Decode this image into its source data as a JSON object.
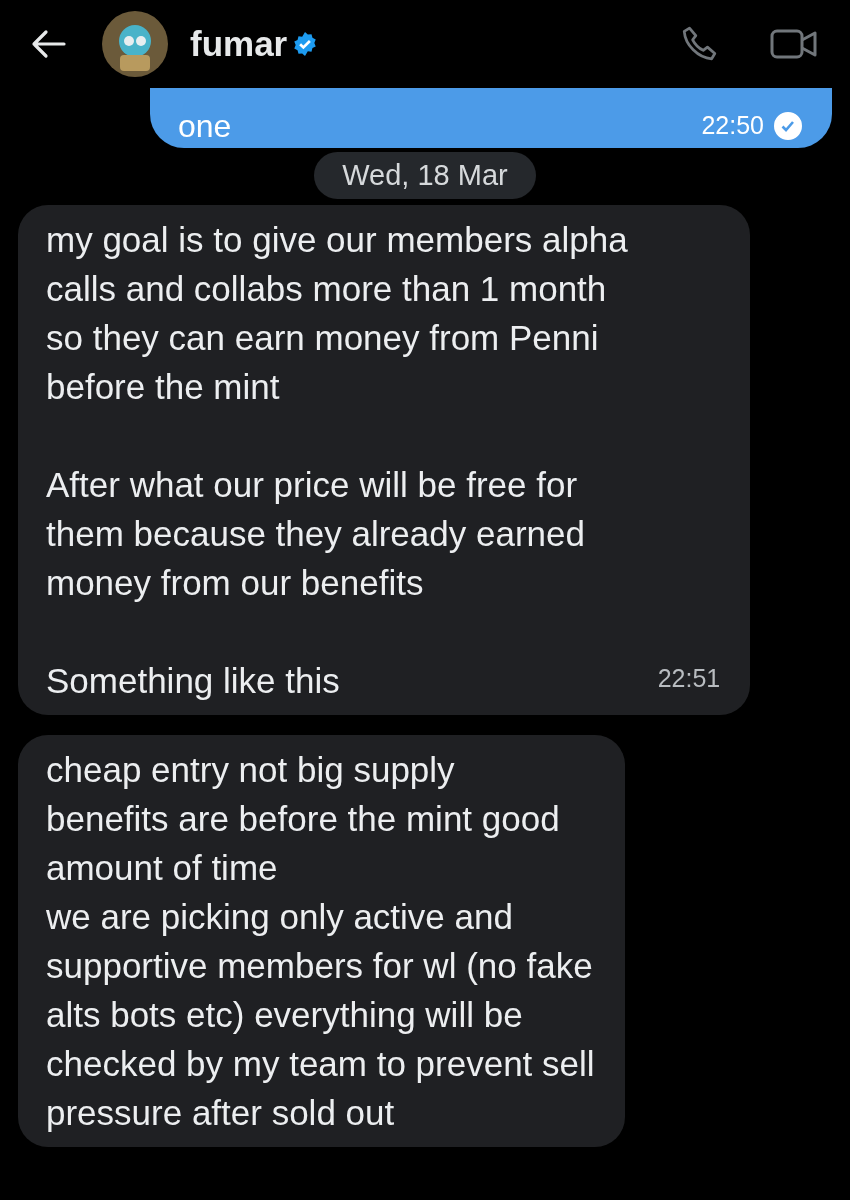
{
  "header": {
    "name": "fumar",
    "verified": true
  },
  "messages": [
    {
      "kind": "sent",
      "text": "one",
      "time": "22:50",
      "read": true
    },
    {
      "kind": "date",
      "text": "Wed, 18 Mar"
    },
    {
      "kind": "received",
      "text": "my goal is to give our members alpha\ncalls and collabs more than 1 month\nso they can earn money from Penni\nbefore the mint\n\nAfter what our price will be free for\nthem because they already earned\nmoney from our benefits\n\nSomething like this",
      "time": "22:51"
    },
    {
      "kind": "received",
      "text": "cheap entry not big supply\nbenefits are before the mint good\namount of time\nwe are picking only active and\nsupportive members for wl (no fake\nalts bots etc) everything will be\nchecked by my team to prevent sell\npressure after sold out"
    }
  ]
}
